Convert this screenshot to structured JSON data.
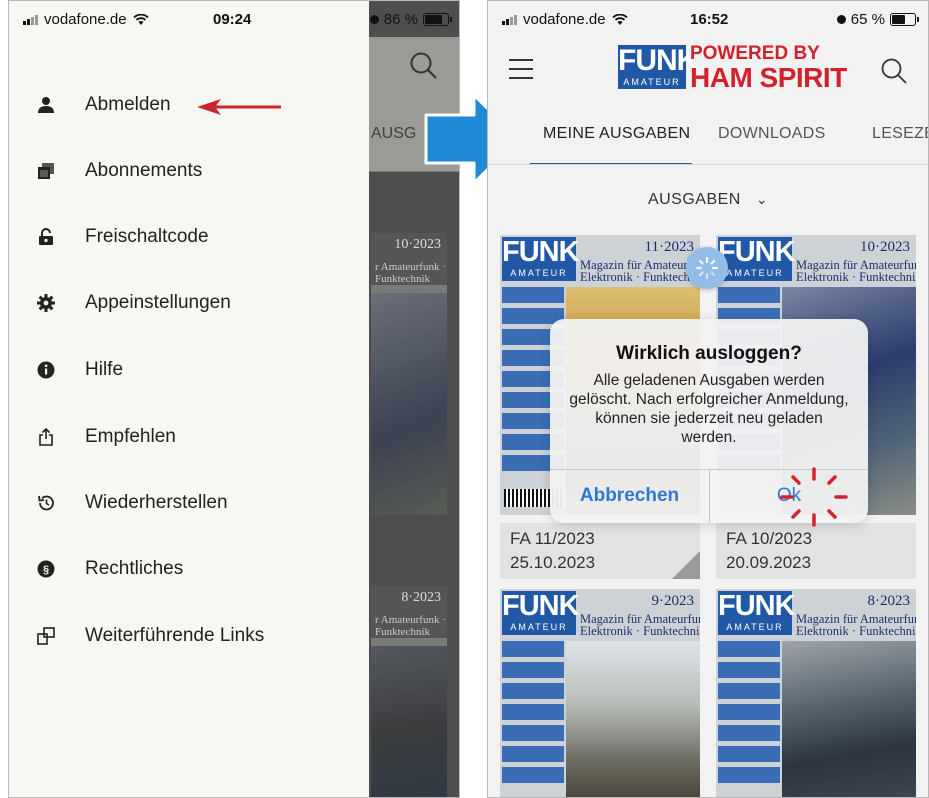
{
  "left_screen": {
    "status_bar": {
      "carrier": "vodafone.de",
      "time": "09:24",
      "battery": "86 %",
      "battery_level": 0.86
    },
    "menu_items": [
      {
        "label": "Abmelden",
        "icon": "user-icon"
      },
      {
        "label": "Abonnements",
        "icon": "stack-icon"
      },
      {
        "label": "Freischaltcode",
        "icon": "lock-open-icon"
      },
      {
        "label": "Appeinstellungen",
        "icon": "gear-icon"
      },
      {
        "label": "Hilfe",
        "icon": "info-icon"
      },
      {
        "label": "Empfehlen",
        "icon": "share-icon"
      },
      {
        "label": "Wiederherstellen",
        "icon": "restore-icon"
      },
      {
        "label": "Rechtliches",
        "icon": "paragraph-icon"
      },
      {
        "label": "Weiterführende Links",
        "icon": "external-links-icon"
      }
    ],
    "background": {
      "tab_fragment": "AUSG",
      "covers": [
        {
          "issue": "10·2023",
          "title": "r Amateurfunk · Funktechnik"
        },
        {
          "issue": "8·2023",
          "title": "r Amateurfunk · Funktechnik"
        }
      ]
    },
    "annotation": {
      "arrow_color": "#c8262b",
      "points_to": "Abmelden"
    }
  },
  "transition_arrow": {
    "color": "#1f8ad6"
  },
  "right_screen": {
    "status_bar": {
      "carrier": "vodafone.de",
      "time": "16:52",
      "battery": "65 %",
      "battery_level": 0.65
    },
    "header": {
      "logo_main": "FUNK",
      "logo_sub": "AMATEUR",
      "logo_powered": "POWERED BY",
      "logo_brand": "HAM SPIRIT",
      "brand_colors": {
        "funk_blue": "#2158a6",
        "ham_red": "#d4202c"
      }
    },
    "tabs": [
      {
        "label": "MEINE AUSGABEN",
        "active": true
      },
      {
        "label": "DOWNLOADS",
        "active": false
      },
      {
        "label": "LESEZE",
        "active": false
      }
    ],
    "filter": {
      "label": "AUSGABEN",
      "icon": "chevron-down-icon"
    },
    "issues": [
      {
        "cover_main": "FUNK",
        "cover_sub": "AMATEUR",
        "cover_issue": "11·2023",
        "cover_title": "Magazin für Amateurfunk",
        "cover_title2": "Elektronik · Funktechnik",
        "title": "FA 11/2023",
        "date": "25.10.2023"
      },
      {
        "cover_main": "FUNK",
        "cover_sub": "AMATEUR",
        "cover_issue": "10·2023",
        "cover_title": "Magazin für Amateurfunk",
        "cover_title2": "Elektronik · Funktechnik",
        "title": "FA 10/2023",
        "date": "20.09.2023"
      },
      {
        "cover_main": "FUNK",
        "cover_sub": "AMATEUR",
        "cover_issue": "9·2023",
        "cover_title": "Magazin für Amateurfunk",
        "cover_title2": "Elektronik · Funktechnik"
      },
      {
        "cover_main": "FUNK",
        "cover_sub": "AMATEUR",
        "cover_issue": "8·2023",
        "cover_title": "Magazin für Amateurfunk",
        "cover_title2": "Elektronik · Funktechnik"
      }
    ],
    "dialog": {
      "title": "Wirklich ausloggen?",
      "message": "Alle geladenen Ausgaben werden gelöscht. Nach erfolgreicher Anmeldung, können sie jederzeit neu geladen werden.",
      "cancel_label": "Abbrechen",
      "ok_label": "Ok",
      "highlight_color": "#d8222b"
    }
  }
}
